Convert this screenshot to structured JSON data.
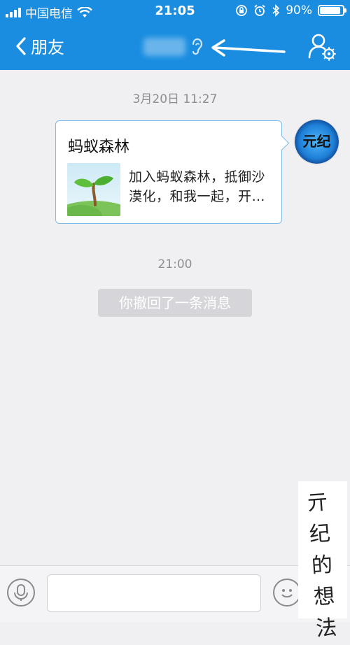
{
  "status_bar": {
    "carrier": "中国电信",
    "time": "21:05",
    "battery": "90%",
    "battery_level": 0.9
  },
  "nav": {
    "back_label": "朋友",
    "icons": [
      "back-chevron-icon",
      "ear-icon",
      "annotation-arrow",
      "profile-settings-icon"
    ]
  },
  "chat": {
    "timestamp_1": "3月20日 11:27",
    "card": {
      "title": "蚂蚁森林",
      "description": "加入蚂蚁森林，抵御沙漠化，和我一起，开…",
      "thumbnail_icon": "sprout-icon"
    },
    "avatar_text": "元纪",
    "timestamp_2": "21:00",
    "recall_notice": "你撤回了一条消息"
  },
  "input_bar": {
    "placeholder": "",
    "icons": [
      "microphone-icon",
      "emoji-icon"
    ]
  },
  "watermark": {
    "text": "亓纪的想法"
  },
  "colors": {
    "accent": "#1a8de0",
    "background": "#f0f0f2",
    "card_border": "#7fbbe8"
  }
}
